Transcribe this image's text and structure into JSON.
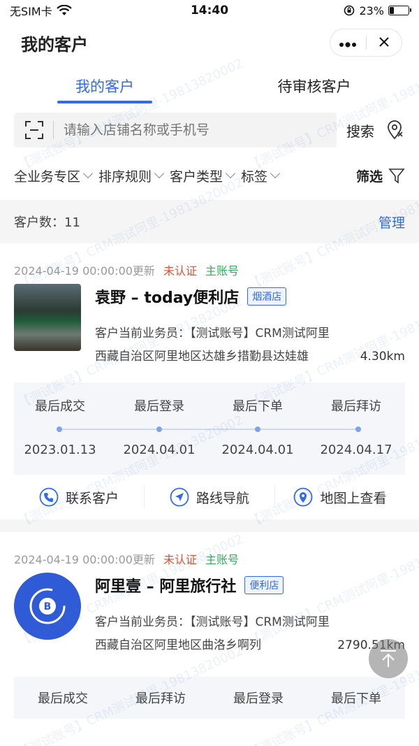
{
  "status": {
    "carrier": "无SIM卡",
    "time": "14:40",
    "battery_text": "23%",
    "battery_level": 0.23
  },
  "nav": {
    "title": "我的客户",
    "more": "•••",
    "close": "✕"
  },
  "tabs": [
    {
      "label": "我的客户",
      "active": true
    },
    {
      "label": "待审核客户",
      "active": false
    }
  ],
  "search": {
    "placeholder": "请输入店铺名称或手机号",
    "button": "搜索"
  },
  "filters": [
    "全业务专区",
    "排序规则",
    "客户类型",
    "标签"
  ],
  "filter_button": "筛选",
  "count": {
    "label": "客户数：",
    "value": "11",
    "manage": "管理"
  },
  "customers": [
    {
      "updated": "2024-04-19 00:00:00更新",
      "auth": "未认证",
      "account": "主账号",
      "name": "袁野 – today便利店",
      "type": "烟酒店",
      "staff": "客户当前业务员：【测试账号】CRM测试阿里",
      "address": "西藏自治区阿里地区达雄乡措勤县达娃雄",
      "distance": "4.30km",
      "timeline": [
        {
          "label": "最后成交",
          "value": "2023.01.13"
        },
        {
          "label": "最后登录",
          "value": "2024.04.01"
        },
        {
          "label": "最后下单",
          "value": "2024.04.01"
        },
        {
          "label": "最后拜访",
          "value": "2024.04.17"
        }
      ]
    },
    {
      "updated": "2024-04-19 00:00:00更新",
      "auth": "未认证",
      "account": "主账号",
      "name": "阿里壹 – 阿里旅行社",
      "type": "便利店",
      "staff": "客户当前业务员：【测试账号】CRM测试阿里",
      "address": "西藏自治区阿里地区曲洛乡啊列",
      "distance": "2790.51km",
      "timeline_labels": [
        "最后成交",
        "最后拜访",
        "最后登录",
        "最后下单"
      ]
    }
  ],
  "actions": [
    {
      "label": "联系客户",
      "icon": "phone-icon"
    },
    {
      "label": "路线导航",
      "icon": "navigation-icon"
    },
    {
      "label": "地图上查看",
      "icon": "map-pin-icon"
    }
  ],
  "watermark": "【测试账号】CRM测试阿里-19813820002",
  "colors": {
    "accent": "#2f6bea",
    "unverified": "#e3502f",
    "main_account": "#2fae5a"
  }
}
